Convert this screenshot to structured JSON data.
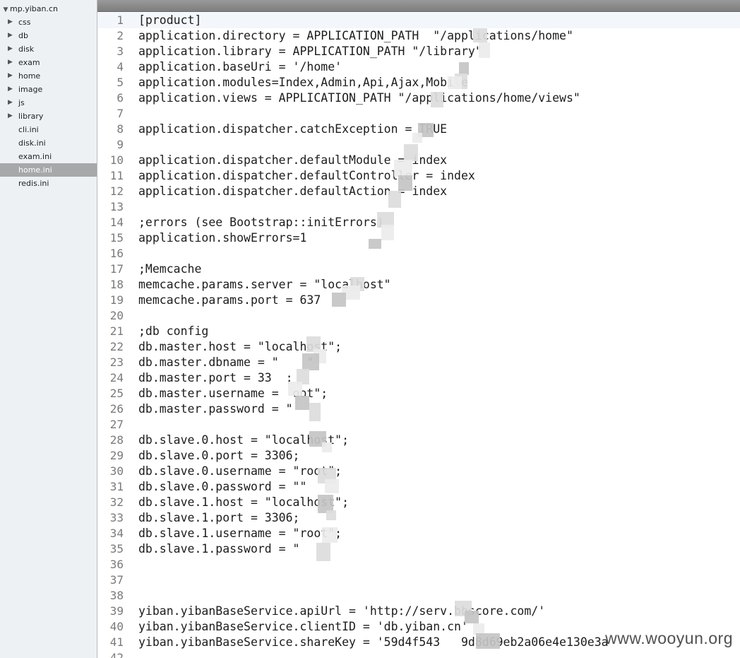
{
  "sidebar": {
    "root": {
      "label": "mp.yiban.cn"
    },
    "items": [
      {
        "label": "css",
        "folder": true
      },
      {
        "label": "db",
        "folder": true
      },
      {
        "label": "disk",
        "folder": true
      },
      {
        "label": "exam",
        "folder": true
      },
      {
        "label": "home",
        "folder": true
      },
      {
        "label": "image",
        "folder": true
      },
      {
        "label": "js",
        "folder": true
      },
      {
        "label": "library",
        "folder": true
      },
      {
        "label": "cli.ini",
        "folder": false
      },
      {
        "label": "disk.ini",
        "folder": false
      },
      {
        "label": "exam.ini",
        "folder": false
      },
      {
        "label": "home.ini",
        "folder": false,
        "selected": true
      },
      {
        "label": "redis.ini",
        "folder": false
      }
    ]
  },
  "editor": {
    "current_line": 1,
    "lines": [
      {
        "n": "1",
        "text": "[product]"
      },
      {
        "n": "2",
        "text": "application.directory = APPLICATION_PATH  \"/applications/home\""
      },
      {
        "n": "3",
        "text": "application.library = APPLICATION_PATH \"/library\""
      },
      {
        "n": "4",
        "text": "application.baseUri = '/home'"
      },
      {
        "n": "5",
        "text": "application.modules=Index,Admin,Api,Ajax,Mobile"
      },
      {
        "n": "6",
        "text": "application.views = APPLICATION_PATH \"/applications/home/views\""
      },
      {
        "n": "7",
        "text": ""
      },
      {
        "n": "8",
        "text": "application.dispatcher.catchException = TRUE"
      },
      {
        "n": "9",
        "text": ""
      },
      {
        "n": "10",
        "text": "application.dispatcher.defaultModule = index"
      },
      {
        "n": "11",
        "text": "application.dispatcher.defaultController = index"
      },
      {
        "n": "12",
        "text": "application.dispatcher.defaultAction = index"
      },
      {
        "n": "13",
        "text": ""
      },
      {
        "n": "14",
        "text": ";errors (see Bootstrap::initErrors)"
      },
      {
        "n": "15",
        "text": "application.showErrors=1"
      },
      {
        "n": "16",
        "text": ""
      },
      {
        "n": "17",
        "text": ";Memcache"
      },
      {
        "n": "18",
        "text": "memcache.params.server = \"localhost\""
      },
      {
        "n": "19",
        "text": "memcache.params.port = 637"
      },
      {
        "n": "20",
        "text": ""
      },
      {
        "n": "21",
        "text": ";db config"
      },
      {
        "n": "22",
        "text": "db.master.host = \"localhost\";"
      },
      {
        "n": "23",
        "text": "db.master.dbname = \"    \""
      },
      {
        "n": "24",
        "text": "db.master.port = 33  ;"
      },
      {
        "n": "25",
        "text": "db.master.username =  oot\";"
      },
      {
        "n": "26",
        "text": "db.master.password = \" "
      },
      {
        "n": "27",
        "text": ""
      },
      {
        "n": "28",
        "text": "db.slave.0.host = \"localhost\";"
      },
      {
        "n": "29",
        "text": "db.slave.0.port = 3306;"
      },
      {
        "n": "30",
        "text": "db.slave.0.username = \"root\";"
      },
      {
        "n": "31",
        "text": "db.slave.0.password = \"\""
      },
      {
        "n": "32",
        "text": "db.slave.1.host = \"localhost\";"
      },
      {
        "n": "33",
        "text": "db.slave.1.port = 3306;"
      },
      {
        "n": "34",
        "text": "db.slave.1.username = \"root\";"
      },
      {
        "n": "35",
        "text": "db.slave.1.password = \""
      },
      {
        "n": "36",
        "text": ""
      },
      {
        "n": "37",
        "text": ""
      },
      {
        "n": "38",
        "text": ""
      },
      {
        "n": "39",
        "text": "yiban.yibanBaseService.apiUrl = 'http://serv.bbscore.com/'"
      },
      {
        "n": "40",
        "text": "yiban.yibanBaseService.clientID = 'db.yiban.cn'"
      },
      {
        "n": "41",
        "text": "yiban.yibanBaseService.shareKey = '59d4f543   9d8d69eb2a06e4e130e3a"
      },
      {
        "n": "42",
        "text": ""
      }
    ]
  },
  "watermark": {
    "text": "www.wooyun.org"
  },
  "colors": {
    "sidebar_bg": "#eef1f4",
    "selected_bg": "#a6a8aa",
    "topbar": "#8a8a8a",
    "text": "#1c1c1c",
    "line_number": "#7a7a7a"
  }
}
